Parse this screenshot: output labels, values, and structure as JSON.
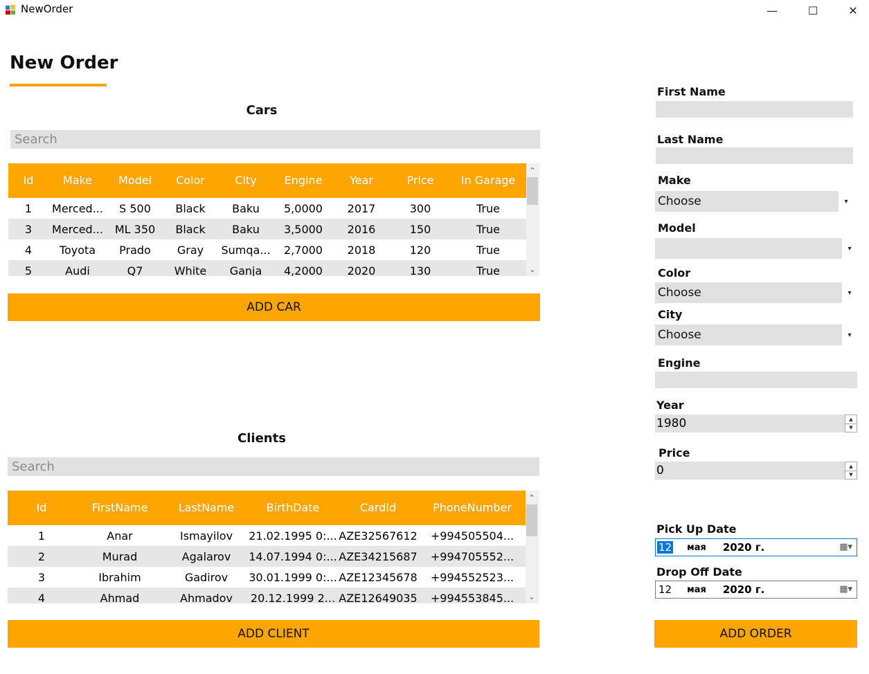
{
  "window": {
    "title": "NewOrder",
    "minimize": "—",
    "maximize": "☐",
    "close": "✕"
  },
  "page": {
    "title": "New Order"
  },
  "cars": {
    "title": "Cars",
    "search_placeholder": "Search",
    "columns": [
      "Id",
      "Make",
      "Model",
      "Color",
      "City",
      "Engine",
      "Year",
      "Price",
      "In Garage"
    ],
    "rows": [
      [
        "1",
        "Merced...",
        "S 500",
        "Black",
        "Baku",
        "5,0000",
        "2017",
        "300",
        "True"
      ],
      [
        "3",
        "Merced...",
        "ML 350",
        "Black",
        "Baku",
        "3,5000",
        "2016",
        "150",
        "True"
      ],
      [
        "4",
        "Toyota",
        "Prado",
        "Gray",
        "Sumqa...",
        "2,7000",
        "2018",
        "120",
        "True"
      ],
      [
        "5",
        "Audi",
        "Q7",
        "White",
        "Ganja",
        "4,2000",
        "2020",
        "130",
        "True"
      ]
    ],
    "add_button": "ADD CAR"
  },
  "clients": {
    "title": "Clients",
    "search_placeholder": "Search",
    "columns": [
      "Id",
      "FirstName",
      "LastName",
      "BirthDate",
      "CardId",
      "PhoneNumber"
    ],
    "rows": [
      [
        "1",
        "Anar",
        "Ismayilov",
        "21.02.1995 0:...",
        "AZE32567612",
        "+994505504..."
      ],
      [
        "2",
        "Murad",
        "Agalarov",
        "14.07.1994 0:...",
        "AZE34215687",
        "+994705552..."
      ],
      [
        "3",
        "Ibrahim",
        "Gadirov",
        "30.01.1999 0:...",
        "AZE12345678",
        "+994552523..."
      ],
      [
        "4",
        "Ahmad",
        "Ahmadov",
        "20.12.1999 2...",
        "AZE12649035",
        "+994553845..."
      ]
    ],
    "add_button": "ADD CLIENT"
  },
  "form": {
    "first_name_label": "First Name",
    "last_name_label": "Last Name",
    "make_label": "Make",
    "make_value": "Choose",
    "model_label": "Model",
    "model_value": "",
    "color_label": "Color",
    "color_value": "Choose",
    "city_label": "City",
    "city_value": "Choose",
    "engine_label": "Engine",
    "year_label": "Year",
    "year_value": "1980",
    "price_label": "Price",
    "price_value": "0",
    "pickup_label": "Pick Up Date",
    "pickup_day": "12",
    "pickup_month": "мая",
    "pickup_year": "2020 г.",
    "dropoff_label": "Drop Off Date",
    "dropoff_day": "12",
    "dropoff_month": "мая",
    "dropoff_year": "2020 г.",
    "add_button": "ADD ORDER"
  },
  "icons": {
    "combo_arrow": "▾",
    "scroll_up": "⌃",
    "scroll_down": "⌄",
    "spin_up": "▲",
    "spin_down": "▼",
    "calendar": "▦▾"
  },
  "colors": {
    "accent": "#FFA500",
    "field_bg": "#e1e1e1",
    "alt_row": "#e6e6e6"
  }
}
